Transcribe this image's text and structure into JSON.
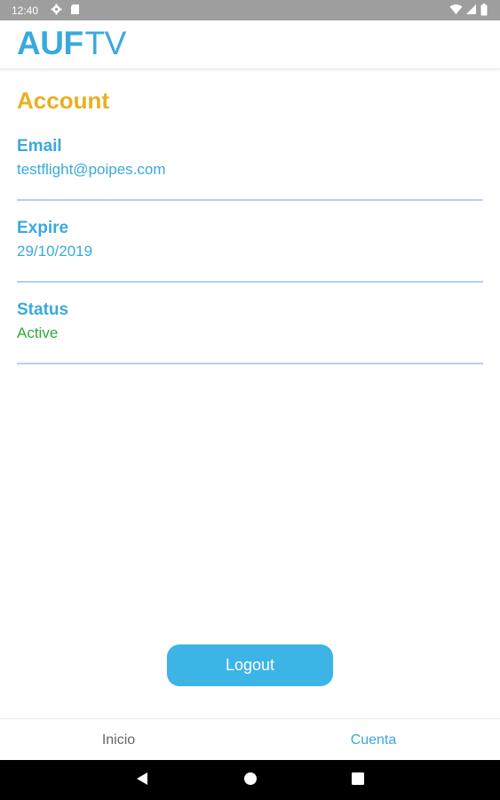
{
  "status_bar": {
    "time": "12:40"
  },
  "header": {
    "logo_bold": "AUF",
    "logo_light": "TV"
  },
  "account": {
    "title": "Account",
    "fields": [
      {
        "label": "Email",
        "value": "testflight@poipes.com"
      },
      {
        "label": "Expire",
        "value": "29/10/2019"
      },
      {
        "label": "Status",
        "value": "Active"
      }
    ]
  },
  "actions": {
    "logout_label": "Logout"
  },
  "bottom_nav": {
    "items": [
      {
        "label": "Inicio",
        "active": false
      },
      {
        "label": "Cuenta",
        "active": true
      }
    ]
  },
  "colors": {
    "brand_blue": "#3aa9dc",
    "title_gold": "#e8b021",
    "status_green": "#2faa3b",
    "button_blue": "#3cb4e6"
  },
  "icons": {
    "status_bar_left": [
      "gear-icon",
      "sd-card-icon"
    ],
    "status_bar_right": [
      "wifi-icon",
      "signal-icon",
      "battery-icon"
    ],
    "android_nav": [
      "back-icon",
      "home-icon",
      "recents-icon"
    ]
  }
}
